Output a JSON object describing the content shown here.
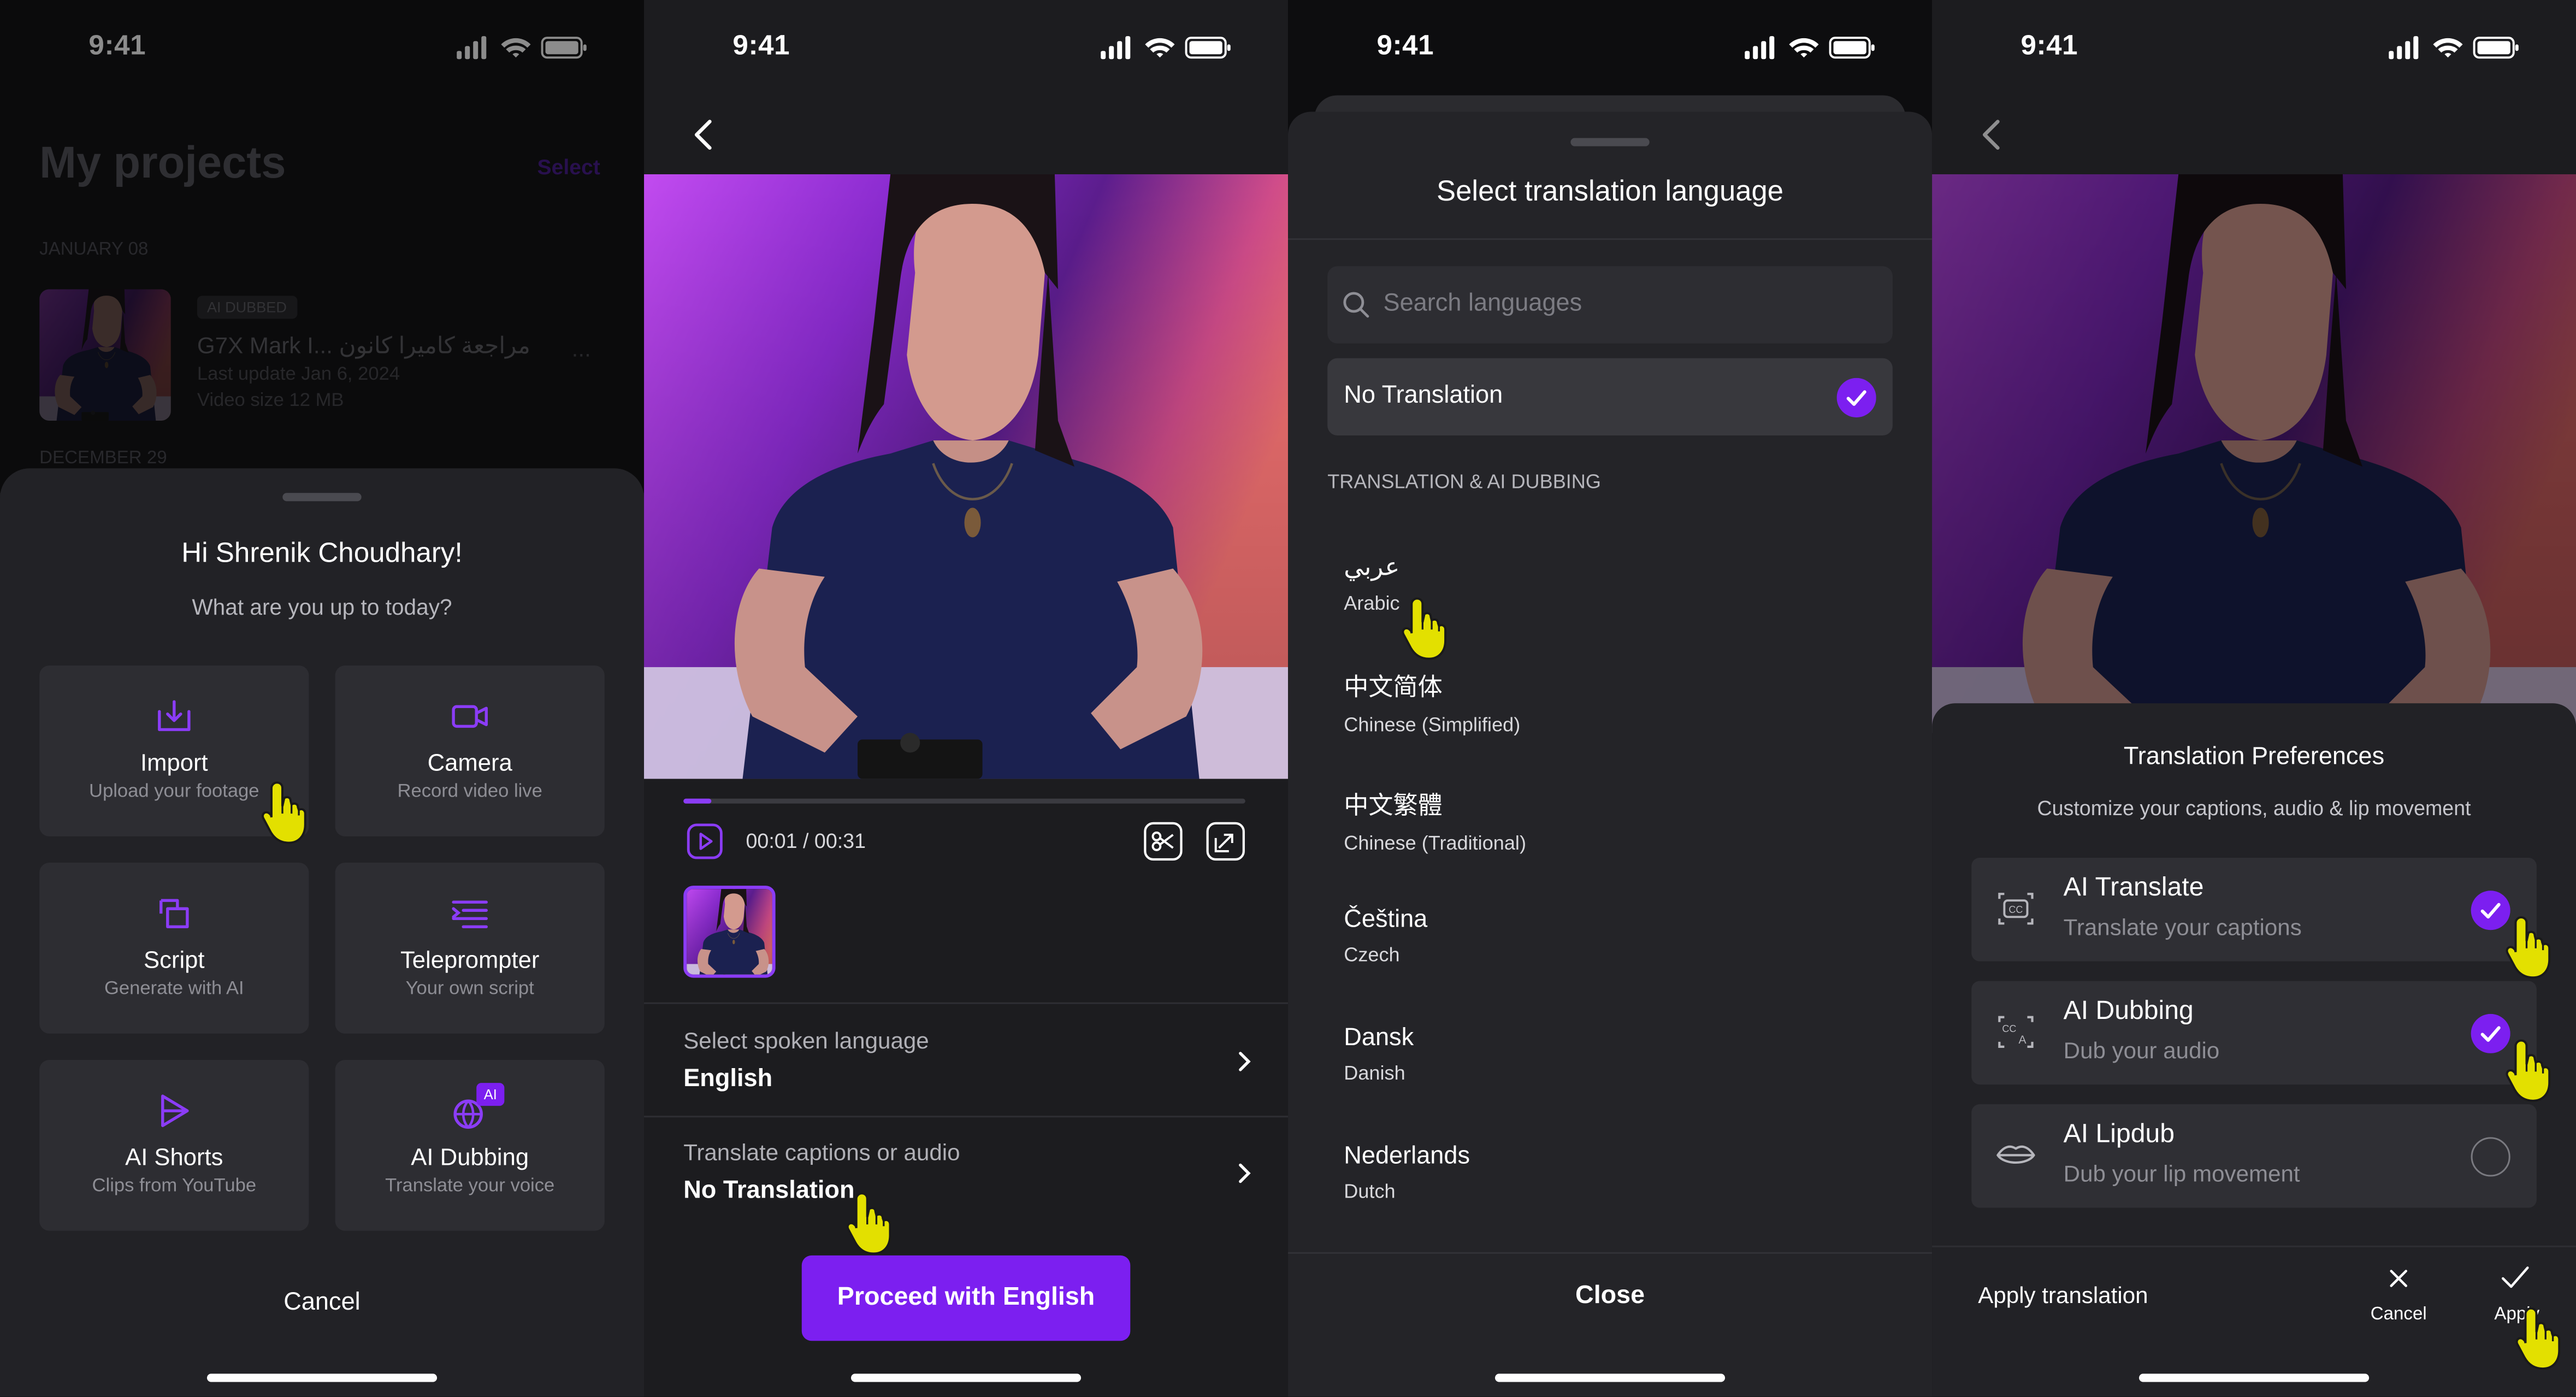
{
  "status_time": "9:41",
  "screen1": {
    "header_title": "My projects",
    "select_label": "Select",
    "section_jan": "JANUARY 08",
    "project": {
      "badge": "AI DUBBED",
      "title": "G7X Mark I... مراجعة كاميرا كانون",
      "updated": "Last update Jan 6, 2024",
      "size": "Video size 12 MB",
      "more": "..."
    },
    "section_dec": "DECEMBER 29",
    "greeting": "Hi Shrenik Choudhary!",
    "subtitle": "What are you up to today?",
    "tiles": [
      {
        "title": "Import",
        "subtitle": "Upload your footage",
        "icon": "import-icon"
      },
      {
        "title": "Camera",
        "subtitle": "Record video live",
        "icon": "camera-icon"
      },
      {
        "title": "Script",
        "subtitle": "Generate with AI",
        "icon": "script-icon"
      },
      {
        "title": "Teleprompter",
        "subtitle": "Your own script",
        "icon": "teleprompter-icon"
      },
      {
        "title": "AI Shorts",
        "subtitle": "Clips from YouTube",
        "icon": "shorts-icon"
      },
      {
        "title": "AI Dubbing",
        "subtitle": "Translate your voice",
        "icon": "dubbing-icon",
        "badge": "AI"
      }
    ],
    "cancel_label": "Cancel"
  },
  "screen2": {
    "timecode": "00:01 / 00:31",
    "progress": 0.05,
    "spoken_label": "Select spoken language",
    "spoken_value": "English",
    "translate_label": "Translate captions or audio",
    "translate_value": "No Translation",
    "proceed_label": "Proceed with English"
  },
  "screen3": {
    "title": "Select translation language",
    "search_placeholder": "Search languages",
    "no_translation": "No Translation",
    "section": "TRANSLATION & AI DUBBING",
    "languages": [
      {
        "native": "عربي",
        "english": "Arabic"
      },
      {
        "native": "中文简体",
        "english": "Chinese (Simplified)"
      },
      {
        "native": "中文繁體",
        "english": "Chinese (Traditional)"
      },
      {
        "native": "Čeština",
        "english": "Czech"
      },
      {
        "native": "Dansk",
        "english": "Danish"
      },
      {
        "native": "Nederlands",
        "english": "Dutch"
      }
    ],
    "close_label": "Close"
  },
  "screen4": {
    "title": "Translation Preferences",
    "subtitle": "Customize your captions, audio & lip movement",
    "options": [
      {
        "title": "AI Translate",
        "subtitle": "Translate your captions",
        "selected": true,
        "icon": "captions-icon"
      },
      {
        "title": "AI Dubbing",
        "subtitle": "Dub your audio",
        "selected": true,
        "icon": "dub-translate-icon"
      },
      {
        "title": "AI Lipdub",
        "subtitle": "Dub your lip movement",
        "selected": false,
        "icon": "lips-icon"
      }
    ],
    "apply_text": "Apply translation",
    "cancel_label": "Cancel",
    "apply_label": "Apply"
  },
  "colors": {
    "accent": "#7C1FF0",
    "background": "#1C1C1F",
    "card": "#2D2D32",
    "pointer": "#E3E000"
  }
}
